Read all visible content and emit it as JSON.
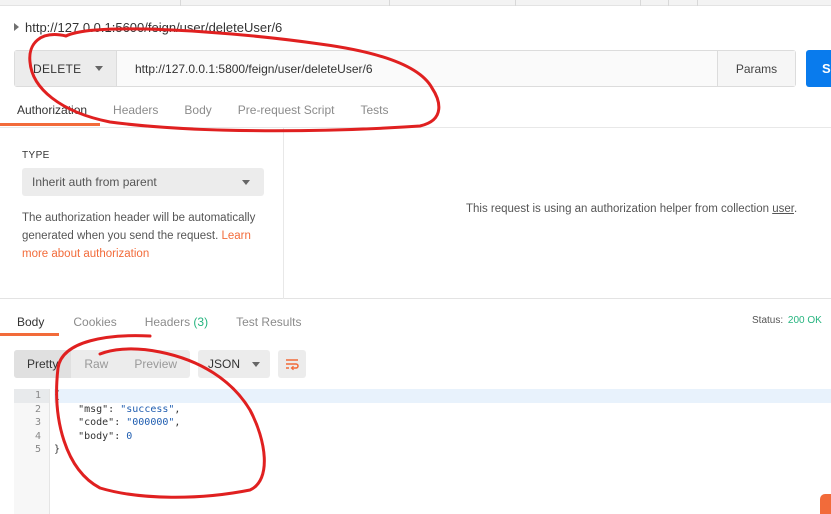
{
  "request": {
    "title": "http://127.0.0.1:5600/feign/user/deleteUser/6",
    "method": "DELETE",
    "url": "http://127.0.0.1:5800/feign/user/deleteUser/6",
    "params_label": "Params",
    "send_label": "S",
    "tabs": [
      "Authorization",
      "Headers",
      "Body",
      "Pre-request Script",
      "Tests"
    ]
  },
  "auth": {
    "type_label": "TYPE",
    "type_value": "Inherit auth from parent",
    "description": "The authorization header will be automatically generated when you send the request.",
    "learn_more": "Learn more about authorization",
    "helper_message": "This request is using an authorization helper from collection",
    "collection_name": "user"
  },
  "response": {
    "tabs": {
      "body": "Body",
      "cookies": "Cookies",
      "headers": "Headers",
      "headers_count": "(3)",
      "test_results": "Test Results"
    },
    "status_label": "Status:",
    "status_value": "200 OK",
    "view_modes": [
      "Pretty",
      "Raw",
      "Preview"
    ],
    "format": "JSON",
    "line_numbers": [
      "1",
      "2",
      "3",
      "4",
      "5"
    ],
    "body_lines": {
      "l1": "{",
      "msg_key": "    \"msg\": ",
      "msg_val": "\"success\"",
      "code_key": "    \"code\": ",
      "code_val": "\"000000\"",
      "body_key": "    \"body\": ",
      "body_val": "0",
      "l5": "}"
    }
  },
  "colors": {
    "accent": "#f26b3a",
    "send_button": "#097bed",
    "status_ok": "#26b47f",
    "annotation": "#e02020"
  },
  "icons": [
    "caret-right-icon",
    "chevron-down-icon",
    "wrap-lines-icon"
  ]
}
